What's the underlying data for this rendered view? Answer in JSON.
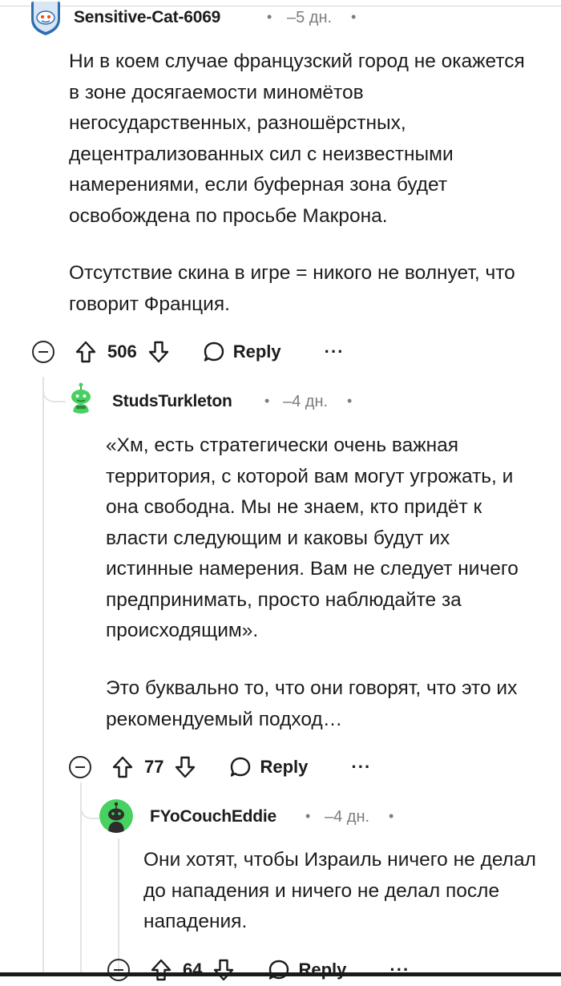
{
  "comments": [
    {
      "author": "Sensitive-Cat-6069",
      "time": "5 дн.",
      "paragraphs": [
        "Ни в коем случае французский город не окажется в зоне досягаемости миномётов негосударственных, разношёрстных, децентрализованных сил с неизвестными намерениями, если буферная зона будет освобождена по просьбе Макрона.",
        "Отсутствие скина в игре = никого не волнует, что говорит Франция."
      ],
      "votes": "506",
      "reply_label": "Reply",
      "more_label": "···"
    },
    {
      "author": "StudsTurkleton",
      "time": "4 дн.",
      "paragraphs": [
        "«Хм, есть стратегически очень важная территория, с которой вам могут угрожать, и она свободна. Мы не знаем, кто придёт к власти следующим и каковы будут их истинные намерения. Вам не следует ничего предпринимать, просто наблюдайте за происходящим».",
        "Это буквально то, что они говорят, что это их рекомендуемый подход…"
      ],
      "votes": "77",
      "reply_label": "Reply",
      "more_label": "···"
    },
    {
      "author": "FYoCouchEddie",
      "time": "4 дн.",
      "paragraphs": [
        "Они хотят, чтобы Израиль ничего не делал до нападения и ничего не делал после нападения."
      ],
      "votes": "64",
      "reply_label": "Reply",
      "more_label": "···"
    }
  ],
  "separator": "•",
  "colors": {
    "text": "#1c1c1c",
    "meta": "#7c7c7c",
    "thread": "#e1e3e5",
    "avatar_green": "#46d160",
    "avatar_blue": "#3a7bd5"
  }
}
